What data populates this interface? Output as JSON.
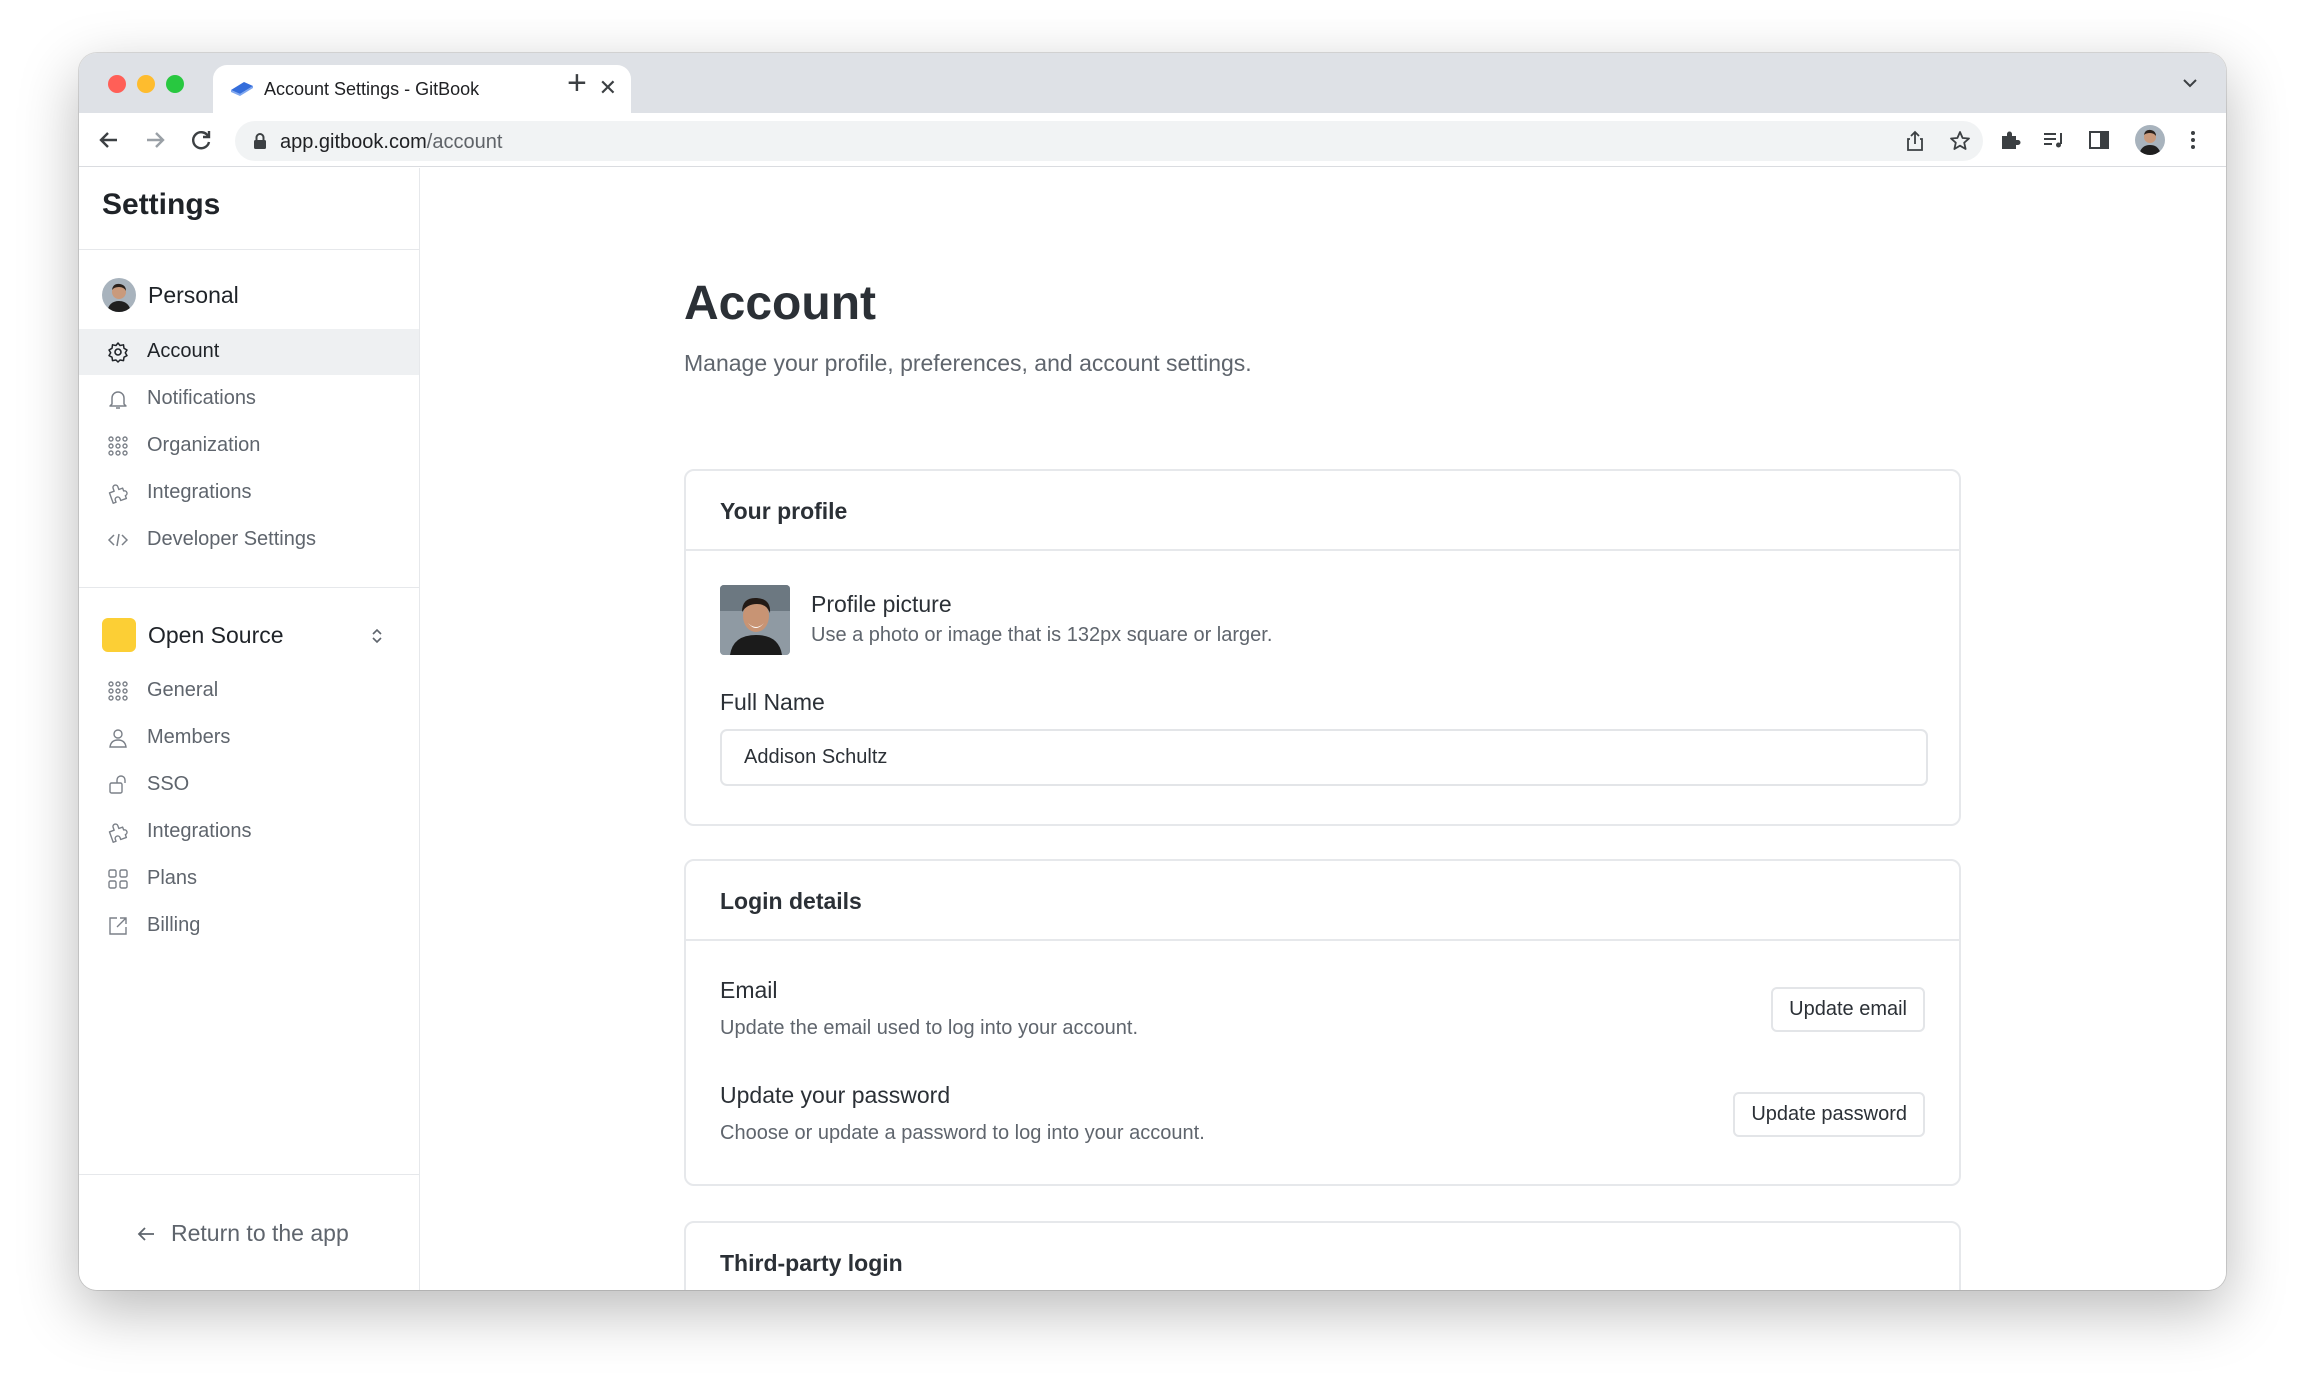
{
  "browser": {
    "tab_title": "Account Settings - GitBook",
    "url_domain": "app.gitbook.com",
    "url_path": "/account"
  },
  "sidebar": {
    "title": "Settings",
    "personal": {
      "label": "Personal",
      "items": [
        {
          "label": "Account",
          "icon": "gear-icon",
          "active": true
        },
        {
          "label": "Notifications",
          "icon": "bell-icon"
        },
        {
          "label": "Organization",
          "icon": "organization-icon"
        },
        {
          "label": "Integrations",
          "icon": "puzzle-icon"
        },
        {
          "label": "Developer Settings",
          "icon": "code-icon"
        }
      ]
    },
    "organization": {
      "label": "Open Source",
      "color": "#fccf35",
      "items": [
        {
          "label": "General",
          "icon": "organization-icon"
        },
        {
          "label": "Members",
          "icon": "members-icon"
        },
        {
          "label": "SSO",
          "icon": "sso-icon"
        },
        {
          "label": "Integrations",
          "icon": "puzzle-icon"
        },
        {
          "label": "Plans",
          "icon": "grid-icon"
        },
        {
          "label": "Billing",
          "icon": "external-link-icon"
        }
      ]
    },
    "return_label": "Return to the app"
  },
  "main": {
    "title": "Account",
    "subtitle": "Manage your profile, preferences, and account settings.",
    "profile_card": {
      "title": "Your profile",
      "picture_label": "Profile picture",
      "picture_desc": "Use a photo or image that is 132px square or larger.",
      "full_name_label": "Full Name",
      "full_name_value": "Addison Schultz"
    },
    "login_card": {
      "title": "Login details",
      "email_label": "Email",
      "email_desc": "Update the email used to log into your account.",
      "email_button": "Update email",
      "password_label": "Update your password",
      "password_desc": "Choose or update a password to log into your account.",
      "password_button": "Update password"
    },
    "third_party_card": {
      "title": "Third-party login"
    }
  }
}
